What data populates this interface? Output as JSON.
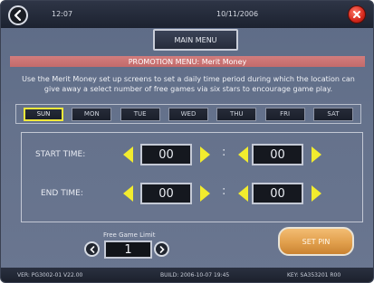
{
  "topbar": {
    "time": "12:07",
    "date": "10/11/2006",
    "back_icon": "back-arrow-icon",
    "close_icon": "close-icon",
    "close_color": "#d4271b"
  },
  "main_menu": {
    "label": "MAIN MENU"
  },
  "title_bar": {
    "text": "PROMOTION MENU: Merit Money",
    "color": "#c97070"
  },
  "description": "Use the Merit Money set up screens to set a daily time period during which the location can give away a select number of free games via six stars to encourage game play.",
  "days": [
    {
      "label": "SUN",
      "selected": true
    },
    {
      "label": "MON",
      "selected": false
    },
    {
      "label": "TUE",
      "selected": false
    },
    {
      "label": "WED",
      "selected": false
    },
    {
      "label": "THU",
      "selected": false
    },
    {
      "label": "FRI",
      "selected": false
    },
    {
      "label": "SAT",
      "selected": false
    }
  ],
  "start_time": {
    "label": "START TIME:",
    "hours": "00",
    "minutes": "00"
  },
  "end_time": {
    "label": "END TIME:",
    "hours": "00",
    "minutes": "00"
  },
  "separator": ":",
  "free_game_limit": {
    "label": "Free Game Limit",
    "value": "1"
  },
  "set_pin": {
    "label": "SET PIN",
    "color": "#e19f4c"
  },
  "footer": {
    "version": "VER: PG3002-01 V22.00",
    "build": "BUILD: 2006-10-07 19:45",
    "key": "KEY: SA353201 R00"
  },
  "accent_arrow_color": "#f2ec2e"
}
